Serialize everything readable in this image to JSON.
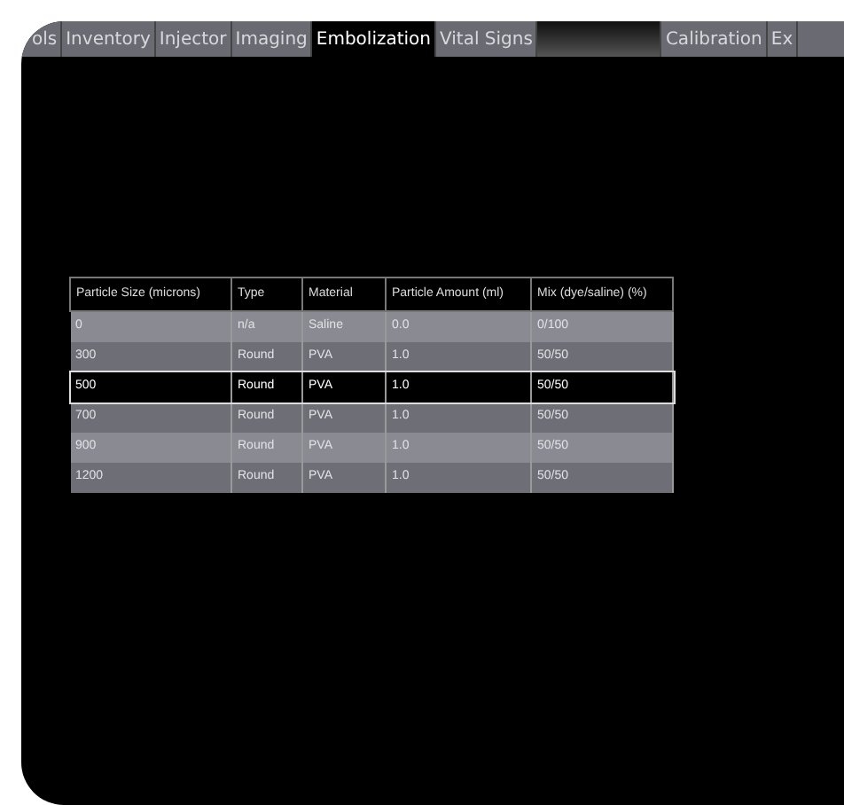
{
  "tabs": [
    {
      "kind": "tab",
      "label": "ols",
      "selected": false
    },
    {
      "kind": "tab",
      "label": "Inventory",
      "selected": false
    },
    {
      "kind": "tab",
      "label": "Injector",
      "selected": false
    },
    {
      "kind": "tab",
      "label": "Imaging",
      "selected": false
    },
    {
      "kind": "tab",
      "label": "Embolization",
      "selected": true
    },
    {
      "kind": "tab",
      "label": "Vital Signs",
      "selected": false
    },
    {
      "kind": "blank",
      "selected": false
    },
    {
      "kind": "tab",
      "label": "Calibration",
      "selected": false
    },
    {
      "kind": "tab",
      "label": "Ex",
      "selected": false
    }
  ],
  "table": {
    "columns": [
      "Particle Size (microns)",
      "Type",
      "Material",
      "Particle Amount (ml)",
      "Mix (dye/saline) (%)"
    ],
    "rows": [
      {
        "cells": [
          "0",
          "n/a",
          "Saline",
          "0.0",
          "0/100"
        ],
        "selected": false
      },
      {
        "cells": [
          "300",
          "Round",
          "PVA",
          "1.0",
          "50/50"
        ],
        "selected": false
      },
      {
        "cells": [
          "500",
          "Round",
          "PVA",
          "1.0",
          "50/50"
        ],
        "selected": true
      },
      {
        "cells": [
          "700",
          "Round",
          "PVA",
          "1.0",
          "50/50"
        ],
        "selected": false
      },
      {
        "cells": [
          "900",
          "Round",
          "PVA",
          "1.0",
          "50/50"
        ],
        "selected": false
      },
      {
        "cells": [
          "1200",
          "Round",
          "PVA",
          "1.0",
          "50/50"
        ],
        "selected": false
      }
    ]
  }
}
